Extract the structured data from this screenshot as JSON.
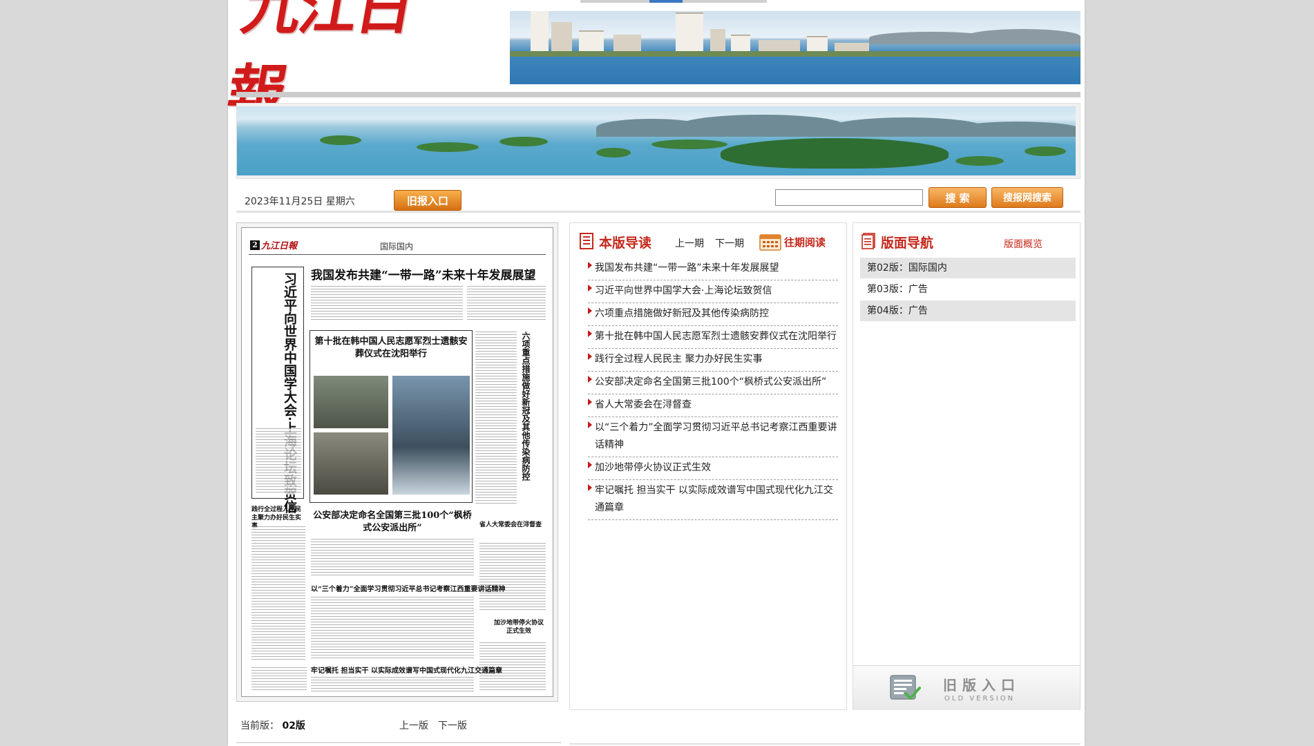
{
  "masthead": {
    "logo_text": "九江日報"
  },
  "toolbar": {
    "date": "2023年11月25日 星期六",
    "old_paper_label": "旧报入口",
    "search_value": "",
    "search_label": "搜 索",
    "search_site_label": "搜报网搜索"
  },
  "newspaper": {
    "page_num": "2",
    "logo": "九江日報",
    "section": "国际国内",
    "headline_main": "我国发布共建“一带一路”未来十年发展展望",
    "headline_vertical": "习近平向世界中国学大会·上海论坛致贺信",
    "headline_photo": "第十批在韩中国人民志愿军烈士遗骸安葬仪式在沈阳举行",
    "headline_right_vertical": "六项重点措施做好新冠及其他传染病防控",
    "headline_police": "公安部决定命名全国第三批100个“枫桥式公安派出所”",
    "small_left": "践行全过程人民民主聚力办好民生实事",
    "small_right": "省人大常委会在浔督查",
    "headline_san": "以“三个着力”全面学习贯彻习近平总书记考察江西重要讲话精神",
    "small_gaza": "加沙地带停火协议正式生效",
    "headline_bottom": "牢记嘱托 担当实干 以实际成效谱写中国式现代化九江交通篇章"
  },
  "edition_nav": {
    "current_label": "当前版：",
    "current_value": "02版",
    "prev_label": "上一版",
    "next_label": "下一版"
  },
  "guide": {
    "title": "本版导读",
    "prev_issue": "上一期",
    "next_issue": "下一期",
    "past_read": "往期阅读",
    "articles": [
      "我国发布共建“一带一路”未来十年发展展望",
      "习近平向世界中国学大会·上海论坛致贺信",
      "六项重点措施做好新冠及其他传染病防控",
      "第十批在韩中国人民志愿军烈士遗骸安葬仪式在沈阳举行",
      "践行全过程人民民主 聚力办好民生实事",
      "公安部决定命名全国第三批100个“枫桥式公安派出所”",
      "省人大常委会在浔督查",
      "以“三个着力”全面学习贯彻习近平总书记考察江西重要讲话精神",
      "加沙地带停火协议正式生效",
      "牢记嘱托 担当实干 以实际成效谱写中国式现代化九江交通篇章"
    ]
  },
  "page_nav": {
    "title": "版面导航",
    "overview": "版面概览",
    "editions": [
      "第02版：国际国内",
      "第03版：广告",
      "第04版：广告"
    ],
    "old_version_cn": "旧版入口",
    "old_version_en": "OLD VERSION"
  },
  "colors": {
    "brand_red": "#c5271b",
    "button_orange": "#de7a1c",
    "logo_red": "#d11a1a"
  },
  "icons": [
    "doc-list-icon",
    "calendar-icon",
    "old-version-icon",
    "red-bullet-icon"
  ]
}
